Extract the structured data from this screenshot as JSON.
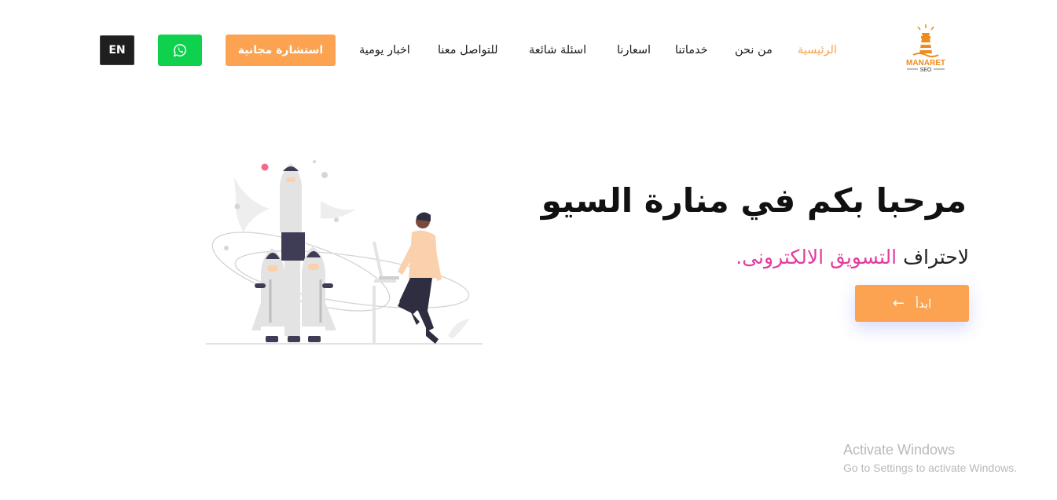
{
  "brand": {
    "logo_line1": "MANARET",
    "logo_line2": "SEO"
  },
  "nav": {
    "items": [
      {
        "label": "الرئيسية",
        "active": true
      },
      {
        "label": "من نحن",
        "active": false
      },
      {
        "label": "خدماتنا",
        "active": false
      },
      {
        "label": "اسعارنا",
        "active": false
      },
      {
        "label": "اسئلة شائعة",
        "active": false
      },
      {
        "label": "للتواصل معنا",
        "active": false
      },
      {
        "label": "اخبار يومية",
        "active": false
      }
    ]
  },
  "header_actions": {
    "consult_label": "استشارة مجانية",
    "whatsapp_icon": "whatsapp-icon",
    "lang_label": "EN"
  },
  "hero": {
    "title": "مرحبا بكم في منارة السيو",
    "subtitle_prefix": "لاحتراف",
    "subtitle_highlight": "التسويق الالكترونى.",
    "start_label": "ابدأ",
    "start_icon": "arrow-left-icon"
  },
  "colors": {
    "accent": "#fba350",
    "highlight": "#e43b9f",
    "whatsapp": "#0ed14e",
    "dark": "#1f1f1f"
  },
  "watermark": {
    "title": "Activate Windows",
    "subtitle": "Go to Settings to activate Windows."
  }
}
